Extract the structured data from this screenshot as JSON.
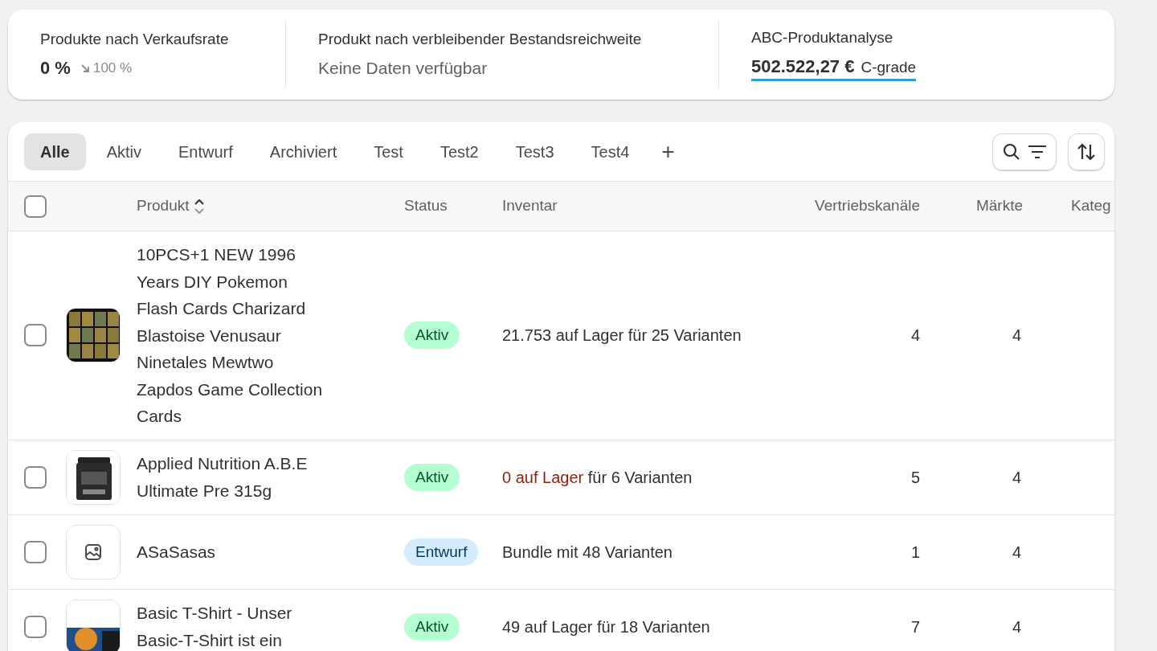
{
  "metrics": [
    {
      "kind": "change",
      "title": "Produkte nach Verkaufsrate",
      "value": "0 %",
      "change": "100 %"
    },
    {
      "kind": "empty",
      "title": "Produkt nach verbleibender Bestandsreichweite",
      "text": "Keine Daten verfügbar"
    },
    {
      "kind": "grade",
      "title": "ABC-Produktanalyse",
      "value": "502.522,27 €",
      "grade": "C-grade"
    }
  ],
  "tabs": [
    {
      "label": "Alle",
      "selected": true
    },
    {
      "label": "Aktiv",
      "selected": false
    },
    {
      "label": "Entwurf",
      "selected": false
    },
    {
      "label": "Archiviert",
      "selected": false
    },
    {
      "label": "Test",
      "selected": false
    },
    {
      "label": "Test2",
      "selected": false
    },
    {
      "label": "Test3",
      "selected": false
    },
    {
      "label": "Test4",
      "selected": false
    }
  ],
  "add_tab": "+",
  "table": {
    "columns": [
      "Produkt",
      "Status",
      "Inventar",
      "Vertriebskanäle",
      "Märkte",
      "Kateg"
    ],
    "select_all_checked": false,
    "rows": [
      {
        "checked": false,
        "name": "10PCS+1 NEW 1996 Years DIY Pokemon Flash Cards Charizard Blastoise Venusaur Ninetales Mewtwo Zapdos Game Collection Cards",
        "status": {
          "kind": "active",
          "label": "Aktiv"
        },
        "inventory": {
          "stock": "21.753 auf Lager",
          "rest": "für 25 Varianten",
          "out_of_stock": false
        },
        "channels": "4",
        "markets": "4"
      },
      {
        "checked": false,
        "name": "Applied Nutrition A.B.E Ultimate Pre 315g",
        "status": {
          "kind": "active",
          "label": "Aktiv"
        },
        "inventory": {
          "stock": "0 auf Lager",
          "rest": "für 6 Varianten",
          "out_of_stock": true
        },
        "channels": "5",
        "markets": "4"
      },
      {
        "checked": false,
        "thumbnail": {
          "kind": "placeholder"
        },
        "name": "ASaSasas",
        "status": {
          "kind": "draft",
          "label": "Entwurf"
        },
        "inventory": {
          "rest": "Bundle mit 48 Varianten"
        },
        "channels": "1",
        "markets": "4"
      },
      {
        "checked": false,
        "name": "Basic T-Shirt - Unser Basic-T-Shirt ist ein",
        "status": {
          "kind": "active",
          "label": "Aktiv"
        },
        "inventory": {
          "stock": "49 auf Lager",
          "rest": "für 18 Varianten",
          "out_of_stock": false
        },
        "channels": "7",
        "markets": "4"
      }
    ]
  }
}
